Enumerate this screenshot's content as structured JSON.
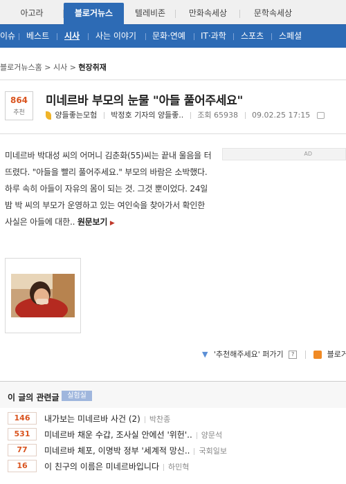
{
  "top_tabs": [
    "아고라",
    "블로거뉴스",
    "텔레비존",
    "만화속세상",
    "문학속세상"
  ],
  "sub_nav": [
    "이슈",
    "베스트",
    "시사",
    "사는 이야기",
    "문화·연예",
    "IT·과학",
    "스포츠",
    "스페셜"
  ],
  "breadcrumb": {
    "home": "블로거뉴스홈",
    "section": "시사",
    "current": "현장취재",
    "sep": ">"
  },
  "article": {
    "vote_count": "864",
    "vote_label": "추천",
    "title": "미네르바 부모의 눈물 \"아들 풀어주세요\"",
    "blog_name": "양들좋는모험",
    "author": "박정호 기자의 양들좋..",
    "views": "조회 65938",
    "date": "09.02.25 17:15",
    "body": "미네르바 박대성 씨의 어머니 김춘화(55)씨는 끝내 울음을 터뜨렸다. \"아들을 빨리 풀어주세요.\" 부모의 바람은 소박했다. 하루 속히 아들이 자유의 몸이 되는 것. 그것 뿐이었다. 24일 밤 박 씨의 부모가 운영하고 있는 여인숙을 찾아가서 확인한 사실은 아들에 대한..",
    "read_more": "원문보기",
    "ad_label": "AD"
  },
  "recommend": {
    "text": "'추천해주세요' 퍼가기",
    "help": "?",
    "rss_label": "블로거.."
  },
  "related": {
    "title": "이 글의 관련글",
    "badge": "실험실",
    "items": [
      {
        "count": "146",
        "title": "내가보는 미네르바 사건 (2)",
        "author": "박찬종"
      },
      {
        "count": "531",
        "title": "미네르바 채운 수갑, 조사실 안에선 '위헌'..",
        "author": "양문석"
      },
      {
        "count": "77",
        "title": "미네르바 체포, 이명박 정부 '세계적 망신..",
        "author": "국회일보"
      },
      {
        "count": "16",
        "title": "이 친구의 이름은 미네르바입니다",
        "author": "하민혁"
      }
    ]
  },
  "colors": {
    "brand_blue": "#2d6bb5",
    "vote_orange": "#d9531e"
  },
  "icons": [
    "feather-icon",
    "print-icon",
    "down-arrow-icon",
    "rss-icon"
  ]
}
